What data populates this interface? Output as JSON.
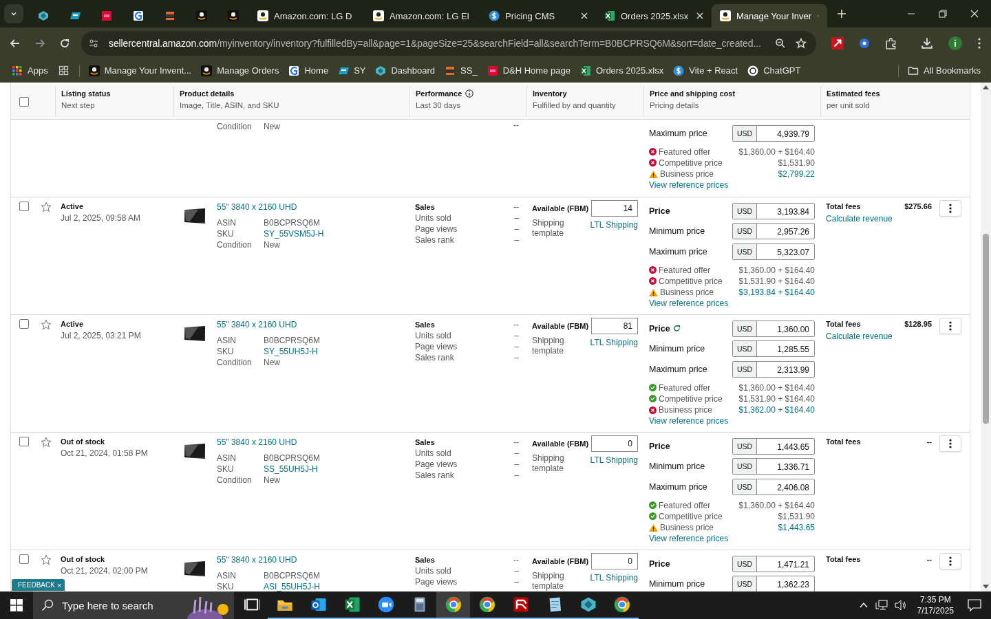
{
  "browser": {
    "tabs": [
      {
        "kind": "diamond",
        "selected": false
      },
      {
        "kind": "ec",
        "selected": false
      },
      {
        "kind": "dh",
        "selected": false
      },
      {
        "kind": "g",
        "selected": false
      },
      {
        "kind": "ss",
        "selected": false
      },
      {
        "kind": "amazon_dark",
        "selected": false
      },
      {
        "kind": "amazon_dark",
        "selected": false
      },
      {
        "kind": "amazon",
        "title": "Amazon.com: LG D",
        "selected": false
      },
      {
        "kind": "amazon",
        "title": "Amazon.com: LG El",
        "selected": false
      },
      {
        "kind": "dollar",
        "title": "Pricing CMS",
        "selected": false
      },
      {
        "kind": "sheet",
        "title": "Orders 2025.xlsx",
        "selected": false
      },
      {
        "kind": "amazon",
        "title": "Manage Your Inver",
        "selected": true
      }
    ],
    "address": {
      "host": "sellercentral.amazon.com",
      "path": "/myinventory/inventory?fulfilledBy=all&page=1&pageSize=25&searchField=all&searchTerm=B0BCPRSQ6M&sort=date_created..."
    },
    "bookmarks": [
      {
        "kind": "apps",
        "label": "Apps"
      },
      {
        "kind": "grid"
      },
      {
        "kind": "amazon_dark",
        "label": "Manage Your Invent..."
      },
      {
        "kind": "amazon_dark",
        "label": "Manage Orders"
      },
      {
        "kind": "g",
        "label": "Home"
      },
      {
        "kind": "ec",
        "label": "SY"
      },
      {
        "kind": "diamond",
        "label": "Dashboard"
      },
      {
        "kind": "ss",
        "label": "SS_"
      },
      {
        "kind": "dh",
        "label": "D&H Home page"
      },
      {
        "kind": "sheet",
        "label": "Orders 2025.xlsx"
      },
      {
        "kind": "dollar",
        "label": "Vite + React"
      },
      {
        "kind": "chatgpt",
        "label": "ChatGPT"
      }
    ],
    "all_bookmarks": "All Bookmarks"
  },
  "table": {
    "select_all": {
      "checked": false
    },
    "columns": [
      {
        "title": "Listing status",
        "subtitle": "Next step"
      },
      {
        "title": "Product details",
        "subtitle": "Image, Title, ASIN, and SKU"
      },
      {
        "title": "Performance",
        "subtitle": "Last 30 days",
        "info": true
      },
      {
        "title": "Inventory",
        "subtitle": "Fulfilled by and quantity"
      },
      {
        "title": "Price and shipping cost",
        "subtitle": "Pricing details"
      },
      {
        "title": "Estimated fees",
        "subtitle": "per unit sold"
      }
    ],
    "rows": [
      {
        "condition": {
          "label": "Condition",
          "value": "New"
        },
        "perf": [
          {
            "value": "--"
          }
        ],
        "prices": [
          {
            "label": "Maximum price",
            "currency": "USD",
            "value": "4,939.79",
            "kind": "plain"
          }
        ],
        "offers": [
          {
            "label": "Featured offer",
            "value": "$1,360.00 + $164.40",
            "kind": "error",
            "linked": false
          },
          {
            "label": "Competitive price",
            "value": "$1,531.90",
            "kind": "error",
            "linked": false
          },
          {
            "label": "Business price",
            "value": "$2,799.22",
            "kind": "warn",
            "linked": true
          }
        ],
        "reference_link": "View reference prices"
      },
      {
        "checked": false,
        "starred": false,
        "status": "Active",
        "date": "Jul 2, 2025, 09:58 AM",
        "title": "55\" 3840 x 2160 UHD",
        "asin": {
          "label": "ASIN",
          "value": "B0BCPRSQ6M"
        },
        "sku": {
          "label": "SKU",
          "value": "SY_55VSM5J-H"
        },
        "condition": {
          "label": "Condition",
          "value": "New"
        },
        "perf": [
          {
            "label": "Sales",
            "value": "--"
          },
          {
            "label": "Units sold",
            "value": "–"
          },
          {
            "label": "Page views",
            "value": "–"
          },
          {
            "label": "Sales rank",
            "value": "–"
          }
        ],
        "inventory": {
          "label": "Available (FBM)",
          "quantity": "14",
          "shipping_label": "Shipping template",
          "shipping_link": "LTL Shipping"
        },
        "prices": [
          {
            "label": "Price",
            "currency": "USD",
            "value": "3,193.84",
            "kind": "main"
          },
          {
            "label": "Minimum price",
            "currency": "USD",
            "value": "2,957.26",
            "kind": "plain"
          },
          {
            "label": "Maximum price",
            "currency": "USD",
            "value": "5,323.07",
            "kind": "plain"
          }
        ],
        "offers": [
          {
            "label": "Featured offer",
            "value": "$1,360.00 + $164.40",
            "kind": "error",
            "linked": false
          },
          {
            "label": "Competitive price",
            "value": "$1,531.90 + $164.40",
            "kind": "error",
            "linked": false
          },
          {
            "label": "Business price",
            "value": "$3,193.84 + $164.40",
            "kind": "warn",
            "linked": true
          }
        ],
        "reference_link": "View reference prices",
        "fees": {
          "label": "Total fees",
          "value": "$275.66",
          "link": "Calculate revenue"
        }
      },
      {
        "checked": false,
        "starred": false,
        "status": "Active",
        "date": "Jul 2, 2025, 03:21 PM",
        "title": "55\" 3840 x 2160 UHD",
        "asin": {
          "label": "ASIN",
          "value": "B0BCPRSQ6M"
        },
        "sku": {
          "label": "SKU",
          "value": "SY_55UH5J-H"
        },
        "condition": {
          "label": "Condition",
          "value": "New"
        },
        "perf": [
          {
            "label": "Sales",
            "value": "--"
          },
          {
            "label": "Units sold",
            "value": "–"
          },
          {
            "label": "Page views",
            "value": "–"
          },
          {
            "label": "Sales rank",
            "value": "–"
          }
        ],
        "inventory": {
          "label": "Available (FBM)",
          "quantity": "81",
          "shipping_label": "Shipping template",
          "shipping_link": "LTL Shipping"
        },
        "prices": [
          {
            "label": "Price",
            "currency": "USD",
            "value": "1,360.00",
            "kind": "main",
            "refresh": true
          },
          {
            "label": "Minimum price",
            "currency": "USD",
            "value": "1,285.55",
            "kind": "plain"
          },
          {
            "label": "Maximum price",
            "currency": "USD",
            "value": "2,313.99",
            "kind": "plain"
          }
        ],
        "offers": [
          {
            "label": "Featured offer",
            "value": "$1,360.00 + $164.40",
            "kind": "ok",
            "linked": false
          },
          {
            "label": "Competitive price",
            "value": "$1,531.90 + $164.40",
            "kind": "ok",
            "linked": false
          },
          {
            "label": "Business price",
            "value": "$1,362.00 + $164.40",
            "kind": "error",
            "linked": true
          }
        ],
        "reference_link": "View reference prices",
        "fees": {
          "label": "Total fees",
          "value": "$128.95",
          "link": "Calculate revenue"
        }
      },
      {
        "checked": false,
        "starred": false,
        "status": "Out of stock",
        "date": "Oct 21, 2024, 01:58 PM",
        "title": "55\" 3840 x 2160 UHD",
        "asin": {
          "label": "ASIN",
          "value": "B0BCPRSQ6M"
        },
        "sku": {
          "label": "SKU",
          "value": "SS_55UH5J-H"
        },
        "condition": {
          "label": "Condition",
          "value": "New"
        },
        "perf": [
          {
            "label": "Sales",
            "value": "--"
          },
          {
            "label": "Units sold",
            "value": "–"
          },
          {
            "label": "Page views",
            "value": "–"
          },
          {
            "label": "Sales rank",
            "value": "–"
          }
        ],
        "inventory": {
          "label": "Available (FBM)",
          "quantity": "0",
          "shipping_label": "Shipping template",
          "shipping_link": "LTL Shipping"
        },
        "prices": [
          {
            "label": "Price",
            "currency": "USD",
            "value": "1,443.65",
            "kind": "main"
          },
          {
            "label": "Minimum price",
            "currency": "USD",
            "value": "1,336.71",
            "kind": "plain"
          },
          {
            "label": "Maximum price",
            "currency": "USD",
            "value": "2,406.08",
            "kind": "plain"
          }
        ],
        "offers": [
          {
            "label": "Featured offer",
            "value": "$1,360.00 + $164.40",
            "kind": "ok",
            "linked": false
          },
          {
            "label": "Competitive price",
            "value": "$1,531.90",
            "kind": "ok",
            "linked": false
          },
          {
            "label": "Business price",
            "value": "$1,443.65",
            "kind": "warn",
            "linked": true
          }
        ],
        "reference_link": "View reference prices",
        "fees": {
          "label": "Total fees",
          "value": "--"
        }
      },
      {
        "checked": false,
        "starred": false,
        "status": "Out of stock",
        "date": "Oct 21, 2024, 02:00 PM",
        "title": "55\" 3840 x 2160 UHD",
        "asin": {
          "label": "ASIN",
          "value": "B0BCPRSQ6M"
        },
        "sku": {
          "label": "SKU",
          "value": "ASI_55UH5J-H"
        },
        "perf": [
          {
            "label": "Sales",
            "value": "--"
          },
          {
            "label": "Units sold",
            "value": "–"
          },
          {
            "label": "Page views",
            "value": "–"
          }
        ],
        "inventory": {
          "label": "Available (FBM)",
          "quantity": "0",
          "shipping_label": "Shipping template",
          "shipping_link": "LTL Shipping"
        },
        "prices": [
          {
            "label": "Price",
            "currency": "USD",
            "value": "1,471.21",
            "kind": "main"
          },
          {
            "label": "Minimum price",
            "currency": "USD",
            "value": "1,362.23",
            "kind": "plain"
          }
        ],
        "fees": {
          "label": "Total fees",
          "value": "--"
        }
      }
    ]
  },
  "feedback": {
    "label": "FEEDBACK",
    "close": "×"
  },
  "taskbar": {
    "search_placeholder": "Type here to search",
    "apps": [
      {
        "kind": "taskview",
        "running": false,
        "selected": false
      },
      {
        "kind": "folder",
        "running": true,
        "selected": false
      },
      {
        "kind": "outlook",
        "running": true,
        "selected": false
      },
      {
        "kind": "excel",
        "running": true,
        "selected": false
      },
      {
        "kind": "zoom",
        "running": true,
        "selected": false
      },
      {
        "kind": "calculator",
        "running": true,
        "selected": false
      },
      {
        "kind": "chrome",
        "running": true,
        "selected": true
      },
      {
        "kind": "chrome",
        "running": true,
        "selected": false
      },
      {
        "kind": "filezilla",
        "running": true,
        "selected": false
      },
      {
        "kind": "notepad",
        "running": true,
        "selected": false
      },
      {
        "kind": "diamond",
        "running": true,
        "selected": false
      },
      {
        "kind": "chrome",
        "running": true,
        "selected": false
      }
    ],
    "time": "7:35 PM",
    "date": "7/17/2025"
  }
}
